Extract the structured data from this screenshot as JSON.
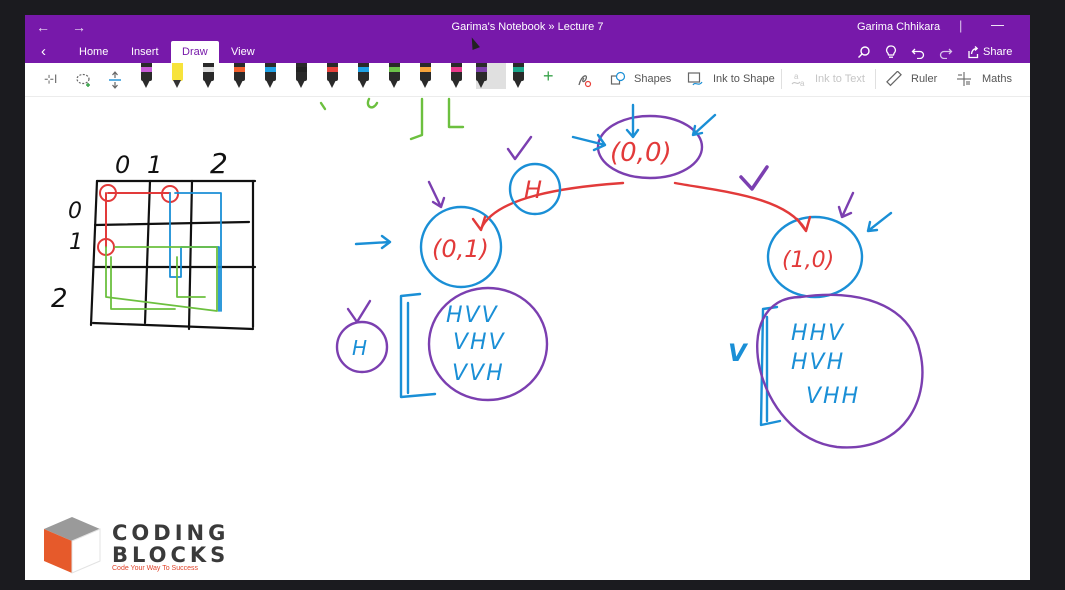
{
  "window": {
    "title": "Garima's Notebook » Lecture 7",
    "user": "Garima Chhikara",
    "separator": "|",
    "minimize": "—",
    "back_arrow": "←",
    "forward_arrow": "→"
  },
  "ribbon": {
    "back": "‹",
    "tabs": [
      {
        "label": "Home"
      },
      {
        "label": "Insert"
      },
      {
        "label": "Draw",
        "active": true
      },
      {
        "label": "View"
      }
    ],
    "icons": {
      "search": "⌕",
      "lightbulb": "💡",
      "undo": "↶",
      "redo": "↷"
    },
    "share_label": "Share"
  },
  "toolbar": {
    "select_icon": "⊹I",
    "lasso_icon": "⟳",
    "add_space_icon": "⇕",
    "add_pen": "+",
    "shapes": "Shapes",
    "ink_to_shape": "Ink to Shape",
    "ink_to_text": "Ink to Text",
    "ruler": "Ruler",
    "maths": "Maths",
    "pens": [
      {
        "color": "#c65bd6",
        "type": "pen"
      },
      {
        "color": "#f7e33b",
        "type": "highlighter"
      },
      {
        "color": "#dddddd",
        "type": "pen"
      },
      {
        "color": "#f25f2c",
        "type": "pen"
      },
      {
        "color": "#1ea1e5",
        "type": "pen"
      },
      {
        "color": "#222222",
        "type": "pen"
      },
      {
        "color": "#e8413a",
        "type": "pen"
      },
      {
        "color": "#1ea1e5",
        "type": "pen"
      },
      {
        "color": "#6cc24a",
        "type": "pen"
      },
      {
        "color": "#f7a43b",
        "type": "pen"
      },
      {
        "color": "#e7398a",
        "type": "pen"
      },
      {
        "color": "#7b3fa8",
        "type": "pen",
        "selected": true
      },
      {
        "color": "#1aa68a",
        "type": "pen"
      }
    ]
  },
  "notes": {
    "grid_col_labels": [
      "0",
      "1",
      "2"
    ],
    "grid_row_labels": [
      "0",
      "1",
      "2"
    ],
    "root_node": "(0,0)",
    "left_node": "(0,1)",
    "right_node": "(1,0)",
    "left_edge_label": "H",
    "right_edge_label": "V",
    "left_bubble_label": "H",
    "right_bracket_label": "V",
    "left_paths": [
      "HVV",
      "VHV",
      "VVH"
    ],
    "right_paths": [
      "HHV",
      "HVH",
      "VHH"
    ]
  },
  "logo": {
    "line1": "CODING",
    "line2": "BLOCKS",
    "tagline": "Code Your Way To Success"
  },
  "colors": {
    "onenote_purple": "#7719aa",
    "ink_red": "#e23a3a",
    "ink_blue": "#1a8fd6",
    "ink_green": "#6cc03f",
    "ink_purple": "#7b3fb0",
    "ink_black": "#111111"
  }
}
